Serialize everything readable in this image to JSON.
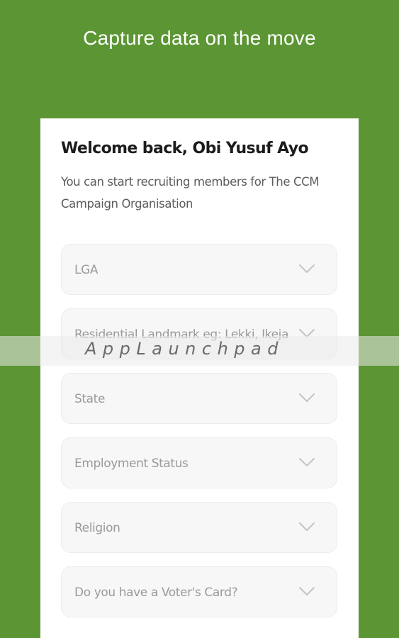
{
  "header": {
    "tagline": "Capture data on the move"
  },
  "card": {
    "welcome": "Welcome back, Obi Yusuf Ayo",
    "subtitle": "You can start recruiting members for The CCM Campaign Organisation"
  },
  "form": {
    "fields": [
      {
        "label": "LGA",
        "icon": "chevron-down-icon"
      },
      {
        "label": "Residential Landmark eg: Lekki, Ikeja",
        "icon": "chevron-down-icon"
      },
      {
        "label": "State",
        "icon": "chevron-down-icon"
      },
      {
        "label": "Employment Status",
        "icon": "chevron-down-icon"
      },
      {
        "label": "Religion",
        "icon": "chevron-down-icon"
      },
      {
        "label": "Do you have a Voter's Card?",
        "icon": "chevron-down-icon"
      }
    ]
  },
  "watermark": {
    "text": "AppLaunchpad"
  },
  "colors": {
    "background": "#5c9634",
    "card": "#ffffff",
    "field_bg": "#f7f7f7",
    "placeholder_text": "#9a9a9a",
    "chevron": "#c4c4c4"
  }
}
